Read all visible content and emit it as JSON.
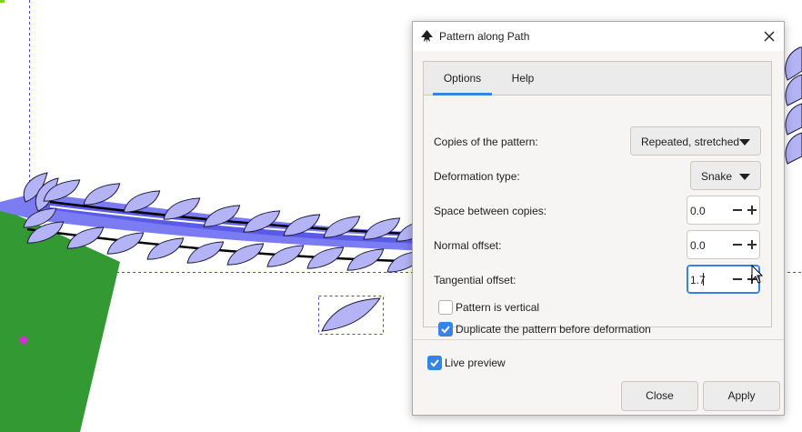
{
  "dialog": {
    "title": "Pattern along Path",
    "tabs": [
      {
        "label": "Options",
        "active": true
      },
      {
        "label": "Help",
        "active": false
      }
    ],
    "copies": {
      "label": "Copies of the pattern:",
      "value": "Repeated, stretched"
    },
    "deformation": {
      "label": "Deformation type:",
      "value": "Snake"
    },
    "space": {
      "label": "Space between copies:",
      "value": "0.0"
    },
    "normal_offset": {
      "label": "Normal offset:",
      "value": "0.0"
    },
    "tangential_offset": {
      "label": "Tangential offset:",
      "value": "1.7"
    },
    "pattern_vertical": {
      "label": "Pattern is vertical",
      "checked": false
    },
    "duplicate": {
      "label": "Duplicate the pattern before deformation",
      "checked": true
    },
    "live_preview": {
      "label": "Live preview",
      "checked": true
    },
    "close_label": "Close",
    "apply_label": "Apply"
  },
  "colors": {
    "accent": "#3584e4",
    "leaf_fill": "#b3b3f5",
    "path_fill": "#7b7bf2",
    "shape_green": "#339933",
    "handle_magenta": "#cc33cc"
  }
}
